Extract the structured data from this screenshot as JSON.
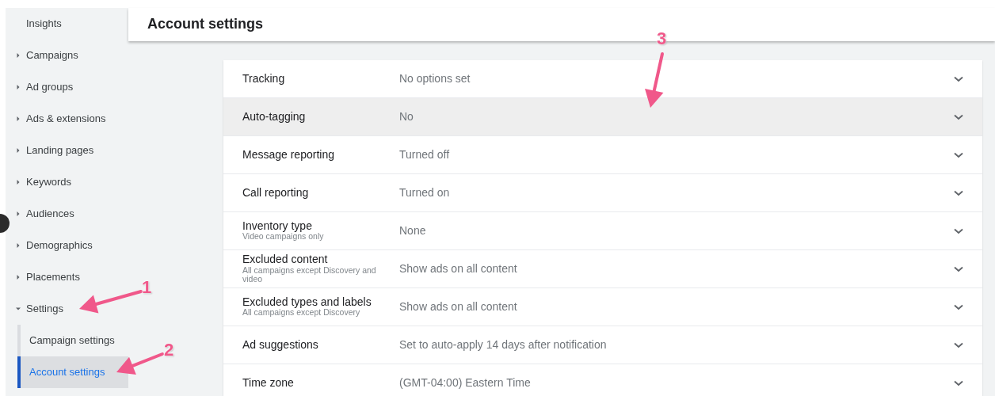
{
  "sidebar": {
    "items": [
      {
        "label": "Insights",
        "kind": "link"
      },
      {
        "label": "Campaigns",
        "kind": "group",
        "expanded": false
      },
      {
        "label": "Ad groups",
        "kind": "group",
        "expanded": false
      },
      {
        "label": "Ads & extensions",
        "kind": "group",
        "expanded": false
      },
      {
        "label": "Landing pages",
        "kind": "group",
        "expanded": false
      },
      {
        "label": "Keywords",
        "kind": "group",
        "expanded": false
      },
      {
        "label": "Audiences",
        "kind": "group",
        "expanded": false
      },
      {
        "label": "Demographics",
        "kind": "group",
        "expanded": false
      },
      {
        "label": "Placements",
        "kind": "group",
        "expanded": false
      },
      {
        "label": "Settings",
        "kind": "group",
        "expanded": true,
        "children": [
          {
            "label": "Campaign settings",
            "selected": false
          },
          {
            "label": "Account settings",
            "selected": true
          }
        ]
      }
    ]
  },
  "header": {
    "title": "Account settings"
  },
  "settings": [
    {
      "label": "Tracking",
      "value": "No options set",
      "highlighted": false
    },
    {
      "label": "Auto-tagging",
      "value": "No",
      "highlighted": true
    },
    {
      "label": "Message reporting",
      "value": "Turned off",
      "highlighted": false
    },
    {
      "label": "Call reporting",
      "value": "Turned on",
      "highlighted": false
    },
    {
      "label": "Inventory type",
      "note": "Video campaigns only",
      "value": "None",
      "highlighted": false
    },
    {
      "label": "Excluded content",
      "note": "All campaigns except Discovery and video",
      "value": "Show ads on all content",
      "highlighted": false
    },
    {
      "label": "Excluded types and labels",
      "note": "All campaigns except Discovery",
      "value": "Show ads on all content",
      "highlighted": false
    },
    {
      "label": "Ad suggestions",
      "value": "Set to auto-apply 14 days after notification",
      "highlighted": false
    },
    {
      "label": "Time zone",
      "value": "(GMT-04:00) Eastern Time",
      "highlighted": false
    }
  ],
  "annotations": [
    {
      "label": "1"
    },
    {
      "label": "2"
    },
    {
      "label": "3"
    }
  ]
}
